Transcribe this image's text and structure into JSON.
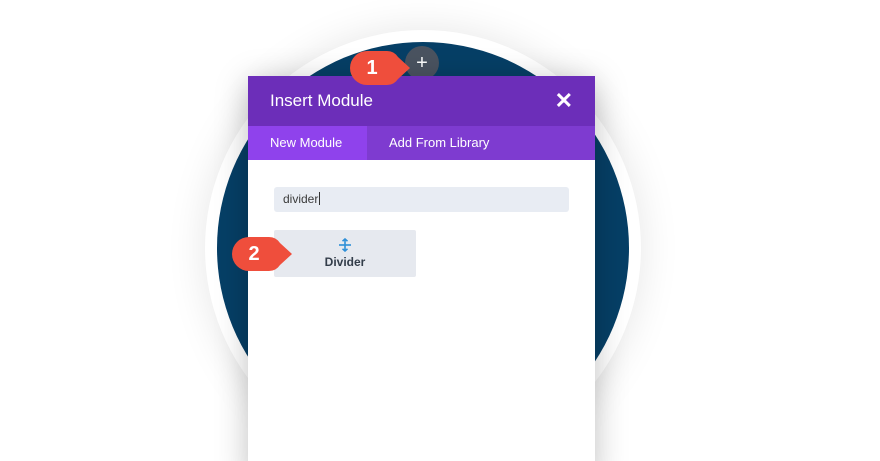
{
  "modal": {
    "title": "Insert Module",
    "close_icon": "close-icon"
  },
  "tabs": [
    {
      "label": "New Module",
      "active": true
    },
    {
      "label": "Add From Library",
      "active": false
    }
  ],
  "search": {
    "value": "divider"
  },
  "modules": [
    {
      "label": "Divider",
      "icon": "divider-icon"
    }
  ],
  "annotations": [
    {
      "number": "1"
    },
    {
      "number": "2"
    }
  ],
  "colors": {
    "header": "#6c2eb9",
    "tabs_bar": "#7e3bd0",
    "active_tab": "#8f42ec",
    "badge": "#ef4e3c",
    "background_circle": "#063f66",
    "icon_blue": "#2e8fd8"
  }
}
